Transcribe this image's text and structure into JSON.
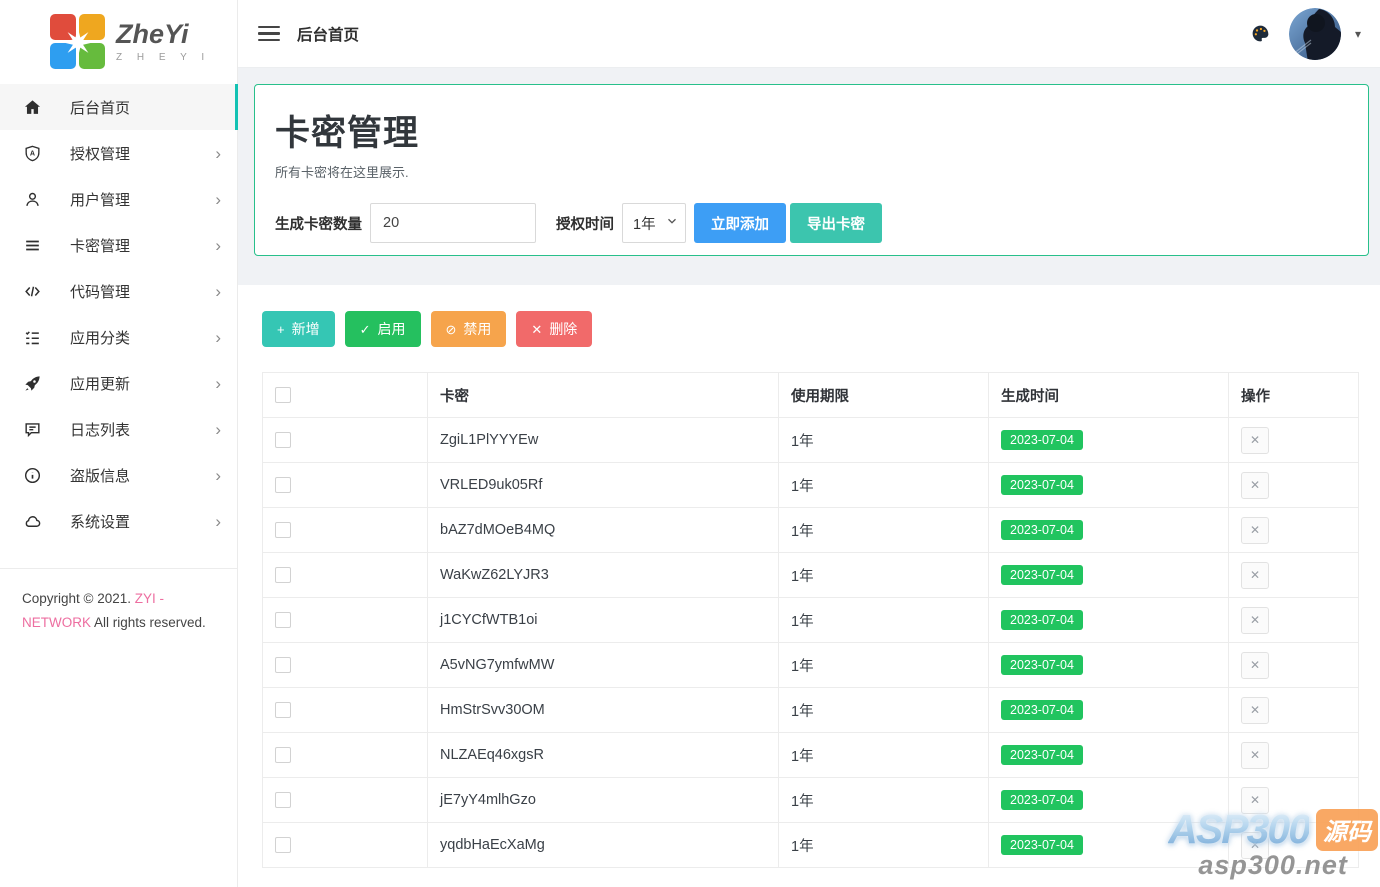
{
  "colors": {
    "accent_teal": "#13c2b3",
    "card_border_green": "#28c08b",
    "button_blue": "#3d9ef5",
    "button_teal": "#3cc5ae",
    "toolbar_teal": "#35c6b4",
    "toolbar_green": "#25c05f",
    "toolbar_orange": "#f6a44c",
    "toolbar_red": "#f16a6a",
    "badge_green": "#21c45f",
    "link_pink": "#ed6ea0"
  },
  "icons": {
    "close": "✕",
    "plus": "+",
    "check": "✓",
    "ban": "⊘",
    "caret_down": "▾",
    "chevron_right": "›"
  },
  "sidebar": {
    "logo": {
      "brand": "ZheYi",
      "sub": "Z H E Y I"
    },
    "items": [
      {
        "label": "后台首页",
        "icon": "home",
        "active": true,
        "arrow": false
      },
      {
        "label": "授权管理",
        "icon": "shield",
        "active": false,
        "arrow": true
      },
      {
        "label": "用户管理",
        "icon": "user",
        "active": false,
        "arrow": true
      },
      {
        "label": "卡密管理",
        "icon": "bars",
        "active": false,
        "arrow": true
      },
      {
        "label": "代码管理",
        "icon": "code",
        "active": false,
        "arrow": true
      },
      {
        "label": "应用分类",
        "icon": "tasks",
        "active": false,
        "arrow": true
      },
      {
        "label": "应用更新",
        "icon": "rocket",
        "active": false,
        "arrow": true
      },
      {
        "label": "日志列表",
        "icon": "comment",
        "active": false,
        "arrow": true
      },
      {
        "label": "盗版信息",
        "icon": "info",
        "active": false,
        "arrow": true
      },
      {
        "label": "系统设置",
        "icon": "cloud",
        "active": false,
        "arrow": true
      }
    ],
    "copyright": {
      "prefix": "Copyright © 2021. ",
      "brand": "ZYI - NETWORK",
      "suffix": " All rights reserved."
    }
  },
  "header": {
    "title": "后台首页"
  },
  "panel": {
    "title": "卡密管理",
    "subtitle": "所有卡密将在这里展示.",
    "qty_label": "生成卡密数量",
    "qty_value": "20",
    "time_label": "授权时间",
    "time_value": "1年",
    "add_button": "立即添加",
    "export_button": "导出卡密"
  },
  "toolbar": {
    "add": "新增",
    "enable": "启用",
    "disable": "禁用",
    "delete": "删除"
  },
  "table": {
    "headers": {
      "code": "卡密",
      "duration": "使用期限",
      "created": "生成时间",
      "actions": "操作"
    },
    "rows": [
      {
        "code": "ZgiL1PlYYYEw",
        "duration": "1年",
        "date": "2023-07-04"
      },
      {
        "code": "VRLED9uk05Rf",
        "duration": "1年",
        "date": "2023-07-04"
      },
      {
        "code": "bAZ7dMOeB4MQ",
        "duration": "1年",
        "date": "2023-07-04"
      },
      {
        "code": "WaKwZ62LYJR3",
        "duration": "1年",
        "date": "2023-07-04"
      },
      {
        "code": "j1CYCfWTB1oi",
        "duration": "1年",
        "date": "2023-07-04"
      },
      {
        "code": "A5vNG7ymfwMW",
        "duration": "1年",
        "date": "2023-07-04"
      },
      {
        "code": "HmStrSvv30OM",
        "duration": "1年",
        "date": "2023-07-04"
      },
      {
        "code": "NLZAEq46xgsR",
        "duration": "1年",
        "date": "2023-07-04"
      },
      {
        "code": "jE7yY4mlhGzo",
        "duration": "1年",
        "date": "2023-07-04"
      },
      {
        "code": "yqdbHaEcXaMg",
        "duration": "1年",
        "date": "2023-07-04"
      }
    ]
  },
  "watermark": {
    "brand": "ASP300",
    "tag": "源码",
    "site": "asp300.net"
  }
}
